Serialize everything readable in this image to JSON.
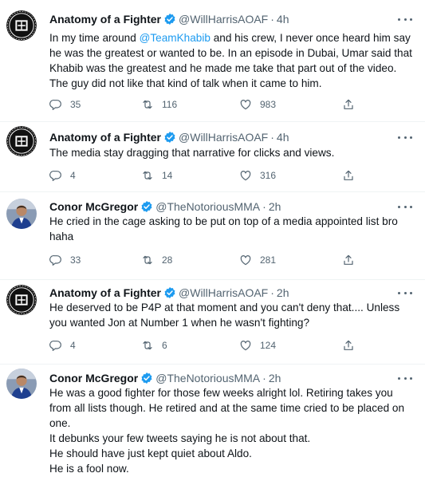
{
  "tweets": [
    {
      "name": "Anatomy of a Fighter",
      "handle": "@WillHarrisAOAF",
      "sep": "·",
      "time": "4h",
      "avatar": "aoaf",
      "lines": [
        [
          "In my time around ",
          "@TeamKhabib",
          " and his crew, I never once heard him say"
        ],
        [
          "he was the greatest or wanted to be. In an episode in Dubai, Umar said that"
        ],
        [
          "Khabib was the greatest and he made me take that part out of the video."
        ],
        [
          "The guy did not like that kind of talk when it came to him."
        ]
      ],
      "replies": "35",
      "retweets": "116",
      "likes": "983"
    },
    {
      "name": "Anatomy of a Fighter",
      "handle": "@WillHarrisAOAF",
      "sep": "·",
      "time": "4h",
      "avatar": "aoaf",
      "lines": [
        [
          "The media stay dragging that narrative for clicks and views."
        ]
      ],
      "replies": "4",
      "retweets": "14",
      "likes": "316"
    },
    {
      "name": "Conor McGregor",
      "handle": "@TheNotoriousMMA",
      "sep": "·",
      "time": "2h",
      "avatar": "conor",
      "lines": [
        [
          "He cried in the cage asking to be put on top of a media appointed list bro"
        ],
        [
          "haha"
        ]
      ],
      "replies": "33",
      "retweets": "28",
      "likes": "281"
    },
    {
      "name": "Anatomy of a Fighter",
      "handle": "@WillHarrisAOAF",
      "sep": "·",
      "time": "2h",
      "avatar": "aoaf",
      "lines": [
        [
          "He deserved to be P4P at that moment and you can't deny that.... Unless"
        ],
        [
          "you wanted Jon at Number 1 when he wasn't fighting?"
        ]
      ],
      "replies": "4",
      "retweets": "6",
      "likes": "124"
    },
    {
      "name": "Conor McGregor",
      "handle": "@TheNotoriousMMA",
      "sep": "·",
      "time": "2h",
      "avatar": "conor",
      "lines": [
        [
          "He was a good fighter for those few weeks alright lol. Retiring takes you"
        ],
        [
          "from all lists though. He retired and at the same time cried to be placed on"
        ],
        [
          "one."
        ],
        [
          "It debunks your few tweets saying he is not about that."
        ],
        [
          "He should have just kept quiet about Aldo."
        ],
        [
          "He is a fool now."
        ]
      ],
      "replies": null,
      "retweets": null,
      "likes": null
    }
  ],
  "colors": {
    "accent": "#1d9bf0",
    "text": "#0f1419",
    "muted": "#536471",
    "divider": "#eff3f4"
  },
  "icons": [
    "verified-badge-icon",
    "more-options-icon",
    "reply-icon",
    "retweet-icon",
    "like-icon",
    "share-icon"
  ]
}
